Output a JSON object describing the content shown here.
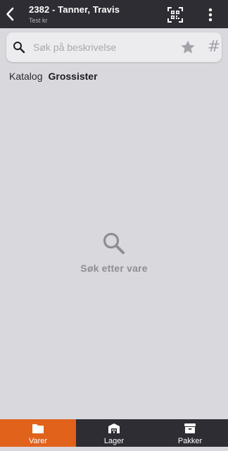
{
  "header": {
    "title": "2382 - Tanner, Travis",
    "subtitle": "Test kr",
    "icons": {
      "back": "chevron-left-icon",
      "scan": "qr-code-scan-icon",
      "more": "more-vertical-icon"
    }
  },
  "search": {
    "placeholder": "Søk på beskrivelse",
    "value": "",
    "hash_label": "#"
  },
  "catalog": {
    "katalog_label": "Katalog",
    "grossister_label": "Grossister"
  },
  "empty_state": {
    "message": "Søk etter vare"
  },
  "bottom_nav": {
    "items": [
      {
        "label": "Varer",
        "icon": "folder-icon",
        "active": true
      },
      {
        "label": "Lager",
        "icon": "warehouse-icon",
        "active": false
      },
      {
        "label": "Pakker",
        "icon": "archive-box-icon",
        "active": false
      }
    ]
  },
  "colors": {
    "header_bg": "#2e2d33",
    "accent": "#e0621b",
    "page_bg": "#d9d8dc"
  }
}
